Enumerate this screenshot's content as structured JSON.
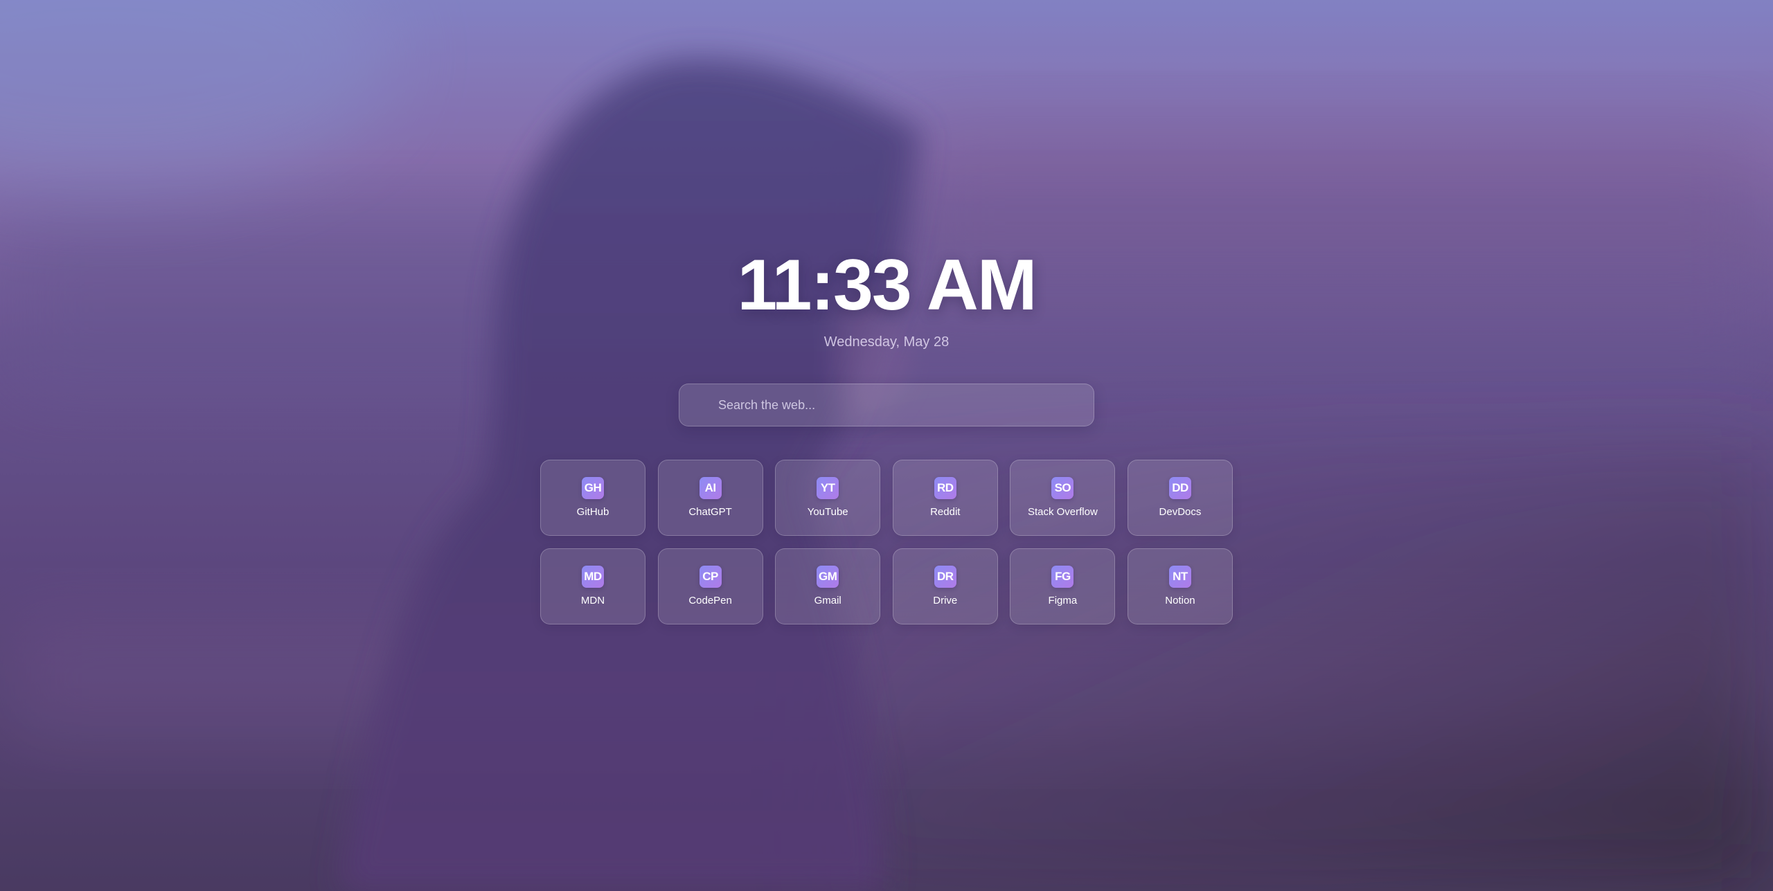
{
  "clock": {
    "time": "11:33 AM",
    "date": "Wednesday, May 28"
  },
  "search": {
    "placeholder": "Search the web...",
    "value": ""
  },
  "shortcuts": [
    {
      "badge": "GH",
      "label": "GitHub"
    },
    {
      "badge": "AI",
      "label": "ChatGPT"
    },
    {
      "badge": "YT",
      "label": "YouTube"
    },
    {
      "badge": "RD",
      "label": "Reddit"
    },
    {
      "badge": "SO",
      "label": "Stack Overflow"
    },
    {
      "badge": "DD",
      "label": "DevDocs"
    },
    {
      "badge": "MD",
      "label": "MDN"
    },
    {
      "badge": "CP",
      "label": "CodePen"
    },
    {
      "badge": "GM",
      "label": "Gmail"
    },
    {
      "badge": "DR",
      "label": "Drive"
    },
    {
      "badge": "FG",
      "label": "Figma"
    },
    {
      "badge": "NT",
      "label": "Notion"
    }
  ],
  "colors": {
    "badge_gradient_start": "#8d8cf4",
    "badge_gradient_end": "#b07be8",
    "text": "#ffffff"
  }
}
